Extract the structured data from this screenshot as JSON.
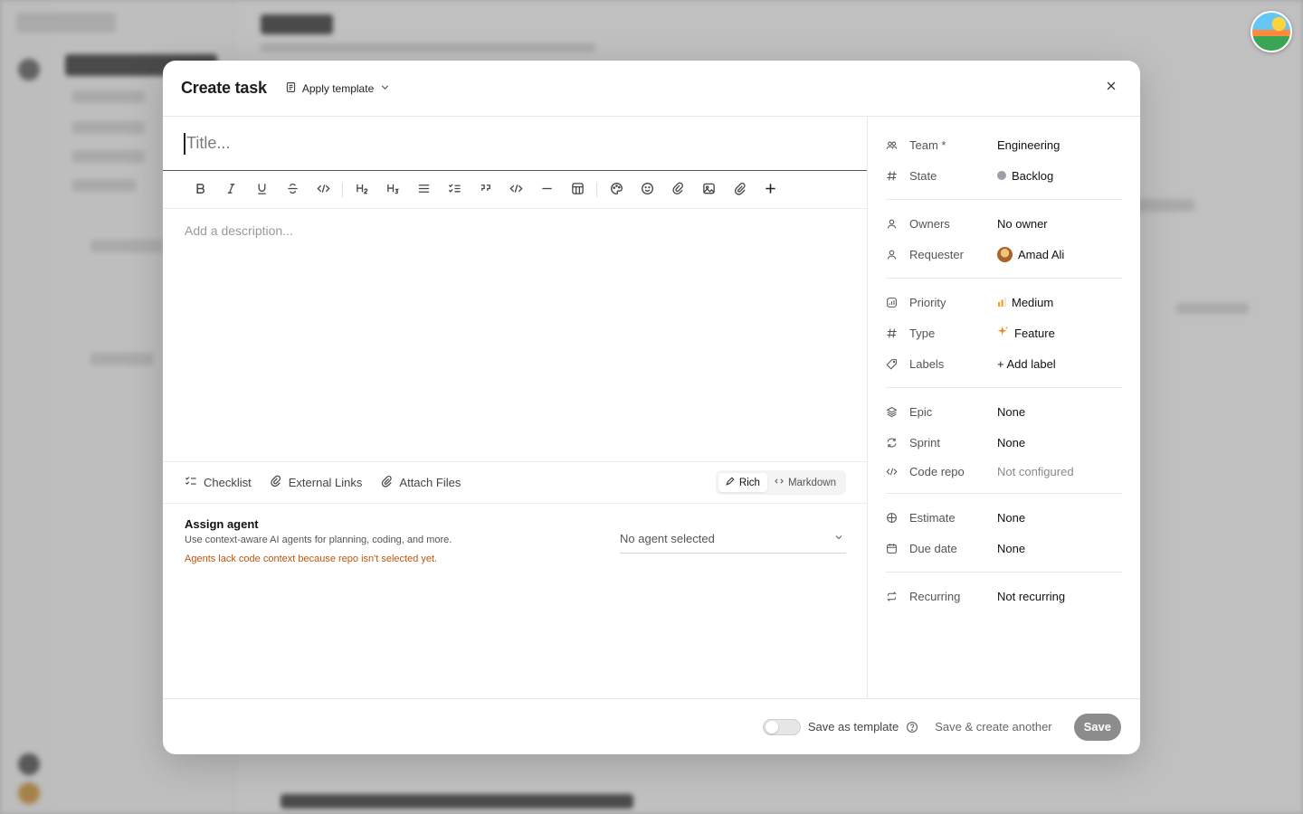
{
  "modal": {
    "title": "Create task",
    "apply_template": "Apply template"
  },
  "editor": {
    "title_placeholder": "Title...",
    "description_placeholder": "Add a description..."
  },
  "attachments": {
    "checklist": "Checklist",
    "external_links": "External Links",
    "attach_files": "Attach Files"
  },
  "mode": {
    "rich": "Rich",
    "markdown": "Markdown",
    "selected": "Rich"
  },
  "agent": {
    "title": "Assign agent",
    "subtitle": "Use context-aware AI agents for planning, coding, and more.",
    "warning": "Agents lack code context because repo isn't selected yet.",
    "select_value": "No agent selected"
  },
  "properties": {
    "team": {
      "label": "Team *",
      "value": "Engineering"
    },
    "state": {
      "label": "State",
      "value": "Backlog"
    },
    "owners": {
      "label": "Owners",
      "value": "No owner"
    },
    "requester": {
      "label": "Requester",
      "value": "Amad Ali"
    },
    "priority": {
      "label": "Priority",
      "value": "Medium"
    },
    "type": {
      "label": "Type",
      "value": "Feature"
    },
    "labels": {
      "label": "Labels",
      "value": "+ Add label"
    },
    "epic": {
      "label": "Epic",
      "value": "None"
    },
    "sprint": {
      "label": "Sprint",
      "value": "None"
    },
    "code_repo": {
      "label": "Code repo",
      "value": "Not configured"
    },
    "estimate": {
      "label": "Estimate",
      "value": "None"
    },
    "due_date": {
      "label": "Due date",
      "value": "None"
    },
    "recurring": {
      "label": "Recurring",
      "value": "Not recurring"
    }
  },
  "footer": {
    "save_as_template": "Save as template",
    "save_create_another": "Save & create another",
    "save": "Save"
  },
  "colors": {
    "priority_medium": "#f0a020",
    "type_feature": "#f08a24",
    "state_backlog": "#9aa0a6",
    "warning_text": "#c0560c",
    "save_button": "#8c8c8c"
  }
}
